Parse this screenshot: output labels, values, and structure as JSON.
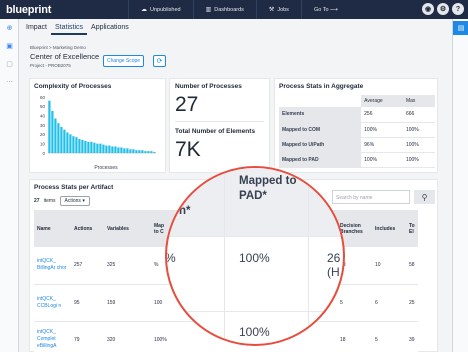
{
  "app": {
    "brand": "blueprint"
  },
  "topnav": {
    "unpublished": "Unpublished",
    "dashboards": "Dashboards",
    "jobs": "Jobs",
    "goto": "Go To ⟶"
  },
  "tabs": [
    "Impact",
    "Statistics",
    "Applications"
  ],
  "breadcrumb": "Blueprint > Marketing Demo",
  "page_title": "Center of Excellence",
  "project": "Project - PROB2075",
  "change_scope": "Change Scope",
  "complexity": {
    "title": "Complexity of Processes",
    "xlabel": "Processes",
    "y_ticks": [
      "60",
      "50",
      "40",
      "30",
      "20",
      "10",
      "0"
    ]
  },
  "chart_data": {
    "type": "bar",
    "title": "Complexity of Processes",
    "xlabel": "Processes",
    "ylabel": "",
    "ylim": [
      0,
      60
    ],
    "values": [
      56,
      45,
      37,
      32,
      28,
      25,
      22,
      20,
      18,
      17,
      15,
      14,
      13,
      12,
      12,
      11,
      10,
      10,
      9,
      8,
      8,
      7,
      7,
      6,
      6,
      5,
      5,
      4,
      4,
      3,
      3,
      3,
      2,
      2,
      2,
      1
    ]
  },
  "num_processes": {
    "label": "Number of Processes",
    "value": "27"
  },
  "num_elements": {
    "label": "Total Number of Elements",
    "value": "7K"
  },
  "aggregate": {
    "title": "Process Stats in Aggregate",
    "headers": [
      "",
      "Average",
      "Max"
    ],
    "rows": [
      [
        "Elements",
        "256",
        "666"
      ],
      [
        "Mapped to COM",
        "100%",
        "100%"
      ],
      [
        "Mapped to UiPath",
        "96%",
        "100%"
      ],
      [
        "Mapped to PAD",
        "100%",
        "100%"
      ]
    ]
  },
  "artifact": {
    "title": "Process Stats per Artifact",
    "count": "27",
    "items_label": "items",
    "actions": "Actions",
    "search_placeholder": "Search by name",
    "headers": [
      "Name",
      "Actions",
      "Variables",
      "Map to C",
      "",
      "",
      "Decision Branches",
      "Includes",
      "To El"
    ],
    "rows": [
      [
        "intQCK_ BillingAr chor",
        "257",
        "325",
        "%",
        "",
        "",
        "10",
        "10",
        "58"
      ],
      [
        "intQCK_ CCBLogi n",
        "95",
        "159",
        "100",
        "",
        "",
        "5",
        "6",
        "25"
      ],
      [
        "intQCK_ Complet eBillingA",
        "79",
        "320",
        "100%",
        "",
        "",
        "18",
        "5",
        "39"
      ]
    ]
  },
  "magnifier": {
    "header_left": "h*",
    "header_main": "Mapped to PAD*",
    "row1_left": "%",
    "row1_main": "100%",
    "row1_right": "26 (H",
    "row2_main": "100%"
  }
}
